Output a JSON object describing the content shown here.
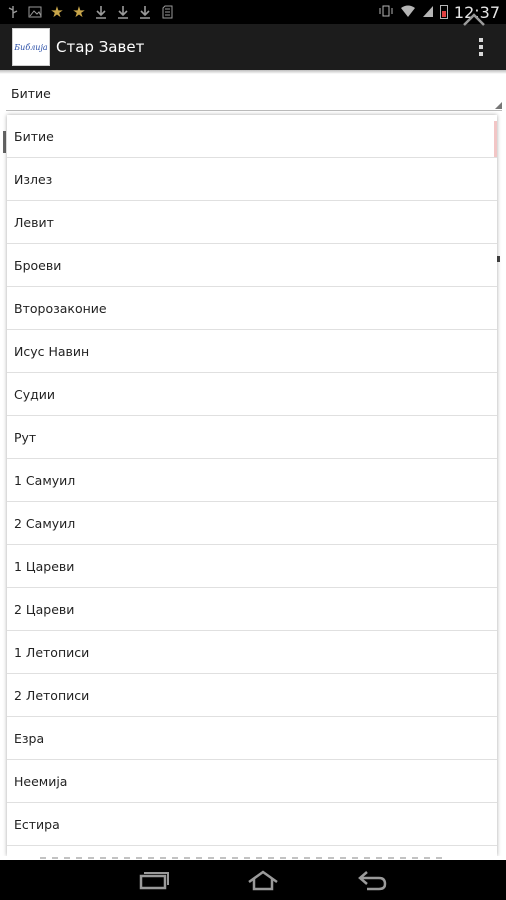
{
  "status_bar": {
    "time": "12:37",
    "left_icons": [
      "usb-icon",
      "image-icon",
      "star-icon",
      "star-icon",
      "download-icon",
      "download-icon",
      "download-icon",
      "sd-card-icon"
    ],
    "right_icons": [
      "vibrate-icon",
      "wifi-icon",
      "signal-icon",
      "battery-icon"
    ],
    "battery_color": "#e04040"
  },
  "action_bar": {
    "logo_text": "Библија",
    "title": "Стар Завет",
    "background": "#1c1c1c"
  },
  "spinner": {
    "selected": "Битие"
  },
  "dropdown": {
    "items": [
      "Битие",
      "Излез",
      "Левит",
      "Броеви",
      "Второзаконие",
      "Исус Навин",
      "Судии",
      "Рут",
      "1 Самуил",
      "2 Самуил",
      "1 Цареви",
      "2 Цареви",
      "1 Летописи",
      "2 Летописи",
      "Езра",
      "Неемија",
      "Естира"
    ]
  },
  "nav_bar": {
    "buttons": [
      "recent-apps-icon",
      "home-icon",
      "back-icon",
      "chevron-up-icon"
    ]
  }
}
